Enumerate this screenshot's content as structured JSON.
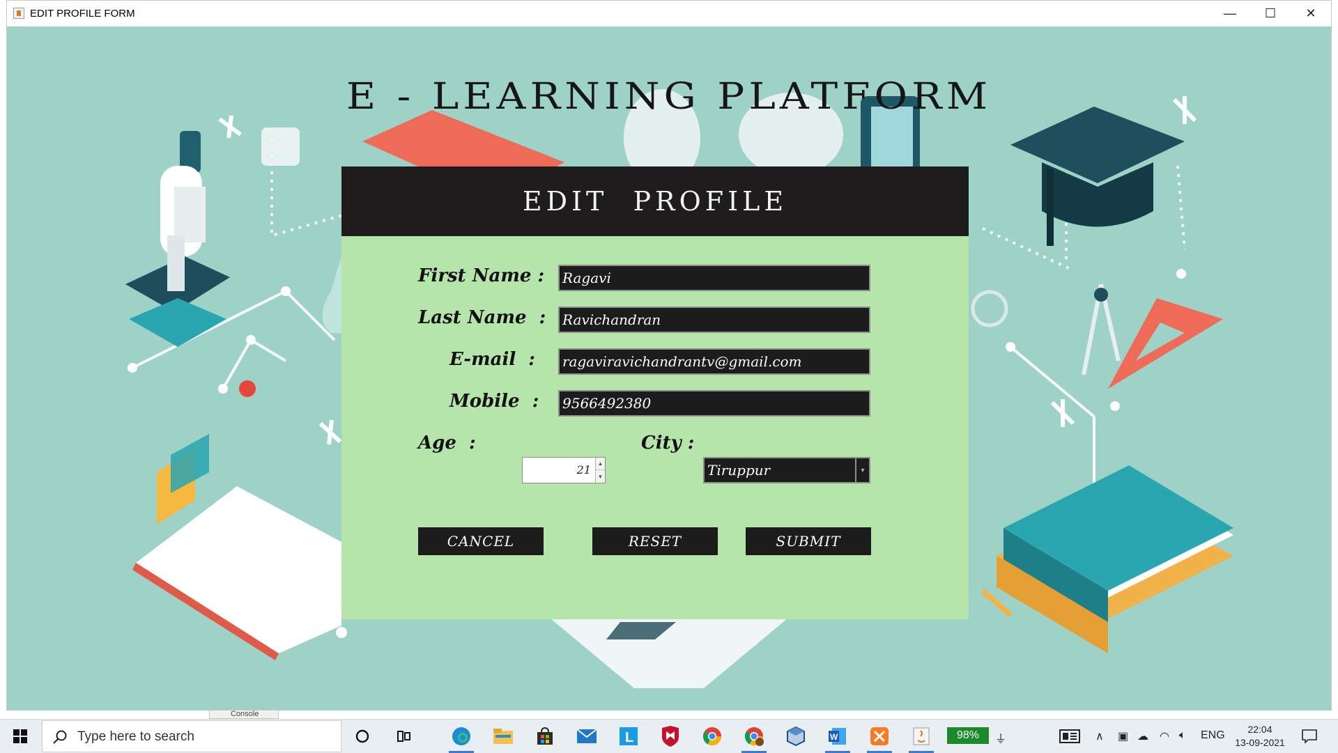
{
  "window": {
    "title": "EDIT PROFILE FORM",
    "controls": {
      "minimize": "—",
      "maximize": "☐",
      "close": "✕"
    }
  },
  "app": {
    "title": "E - LEARNING PLATFORM"
  },
  "form": {
    "heading": "EDIT   PROFILE",
    "labels": {
      "first_name": "First Name :",
      "last_name": "Last Name  :",
      "email": "E-mail  :",
      "mobile": "Mobile  :",
      "age": "Age  :",
      "city": "City :"
    },
    "values": {
      "first_name": "Ragavi",
      "last_name": "Ravichandran",
      "email": "ragaviravichandrantv@gmail.com",
      "mobile": "9566492380",
      "age": "21",
      "city": "Tiruppur"
    },
    "buttons": {
      "cancel": "CANCEL",
      "reset": "RESET",
      "submit": "SUBMIT"
    }
  },
  "background_text": {
    "partial_tab": "Console"
  },
  "taskbar": {
    "search_placeholder": "Type here to search",
    "apps": [
      "cortana-icon",
      "task-view-icon",
      "edge-icon",
      "file-explorer-icon",
      "store-icon",
      "mail-icon",
      "l-app-icon",
      "mcafee-icon",
      "chrome-icon",
      "chrome-profile-icon",
      "virtualbox-icon",
      "word-icon",
      "xampp-icon",
      "java-icon"
    ],
    "battery": "98%",
    "language": "ENG",
    "time": "22:04",
    "date": "13-09-2021"
  },
  "colors": {
    "scene_bg": "#9ed2c7",
    "form_bg": "#b5e5ab",
    "header_bg": "#1f1c1d",
    "accent_coral": "#ee6b57",
    "accent_teal": "#2aa6b0"
  }
}
